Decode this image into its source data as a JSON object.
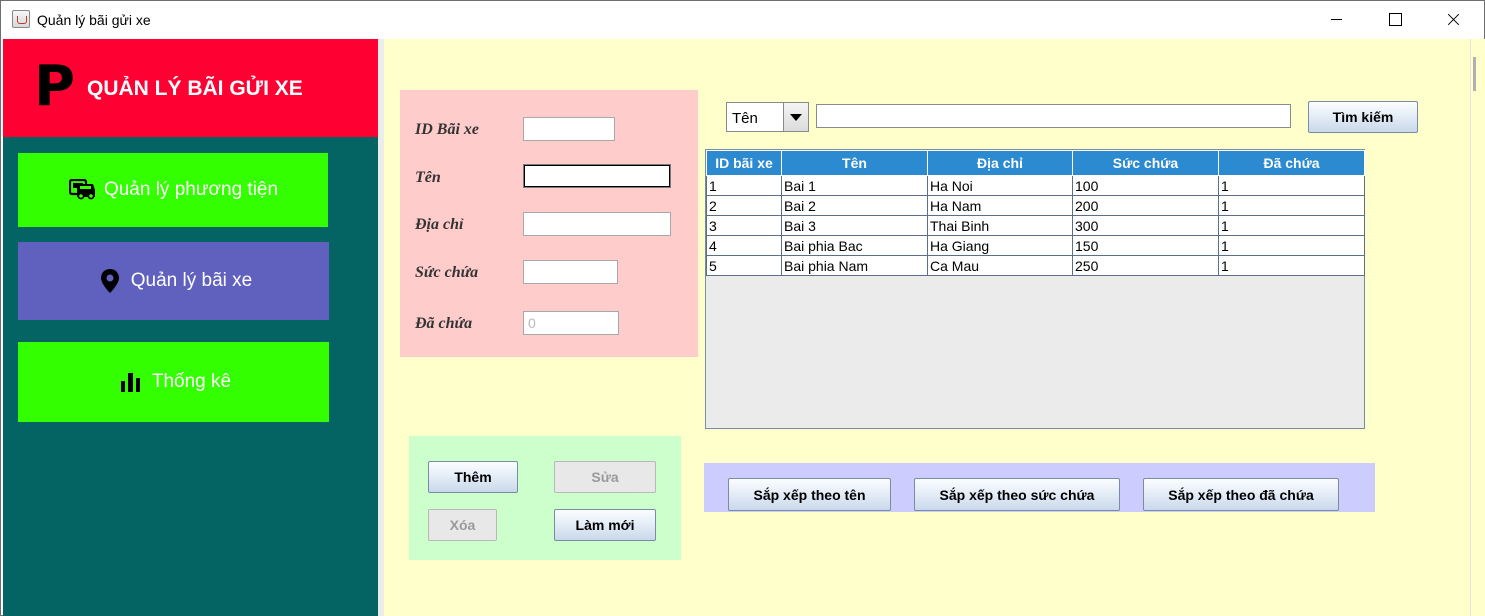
{
  "window": {
    "title": "Quản lý bãi gửi xe"
  },
  "sidebar": {
    "logo_letter": "P",
    "heading": "QUẢN LÝ BÃI GỬI XE",
    "items": [
      {
        "label": "Quản lý phương tiện",
        "icon": "car-icon"
      },
      {
        "label": "Quản lý bãi xe",
        "icon": "map-pin-icon"
      },
      {
        "label": "Thống kê",
        "icon": "bar-chart-icon"
      }
    ]
  },
  "form": {
    "labels": {
      "id": "ID Bãi xe",
      "name": "Tên",
      "address": "Địa chỉ",
      "capacity": "Sức chứa",
      "occupied": "Đã chứa"
    },
    "values": {
      "id": "",
      "name": "",
      "address": "",
      "capacity": "",
      "occupied": "0"
    }
  },
  "search": {
    "field_selected": "Tên",
    "query": "",
    "button_label": "Tìm kiếm"
  },
  "table": {
    "headers": [
      "ID bãi xe",
      "Tên",
      "Địa chỉ",
      "Sức chứa",
      "Đã chứa"
    ],
    "rows": [
      [
        "1",
        "Bai 1",
        "Ha Noi",
        "100",
        "1"
      ],
      [
        "2",
        "Bai 2",
        "Ha Nam",
        "200",
        "1"
      ],
      [
        "3",
        "Bai 3",
        "Thai Binh",
        "300",
        "1"
      ],
      [
        "4",
        "Bai phia Bac",
        "Ha Giang",
        "150",
        "1"
      ],
      [
        "5",
        "Bai phia Nam",
        "Ca Mau",
        "250",
        "1"
      ]
    ]
  },
  "actions": {
    "add": "Thêm",
    "edit": "Sửa",
    "delete": "Xóa",
    "refresh": "Làm mới"
  },
  "sort": {
    "by_name": "Sắp xếp theo tên",
    "by_capacity": "Sắp xếp theo sức chứa",
    "by_occupied": "Sắp xếp theo đã chứa"
  },
  "colors": {
    "sidebar_bg": "#046464",
    "header_red": "#ff0033",
    "nav_green": "#33ff00",
    "nav_active": "#6060bf",
    "main_bg": "#ffffcc",
    "table_header": "#2b8ad0"
  }
}
